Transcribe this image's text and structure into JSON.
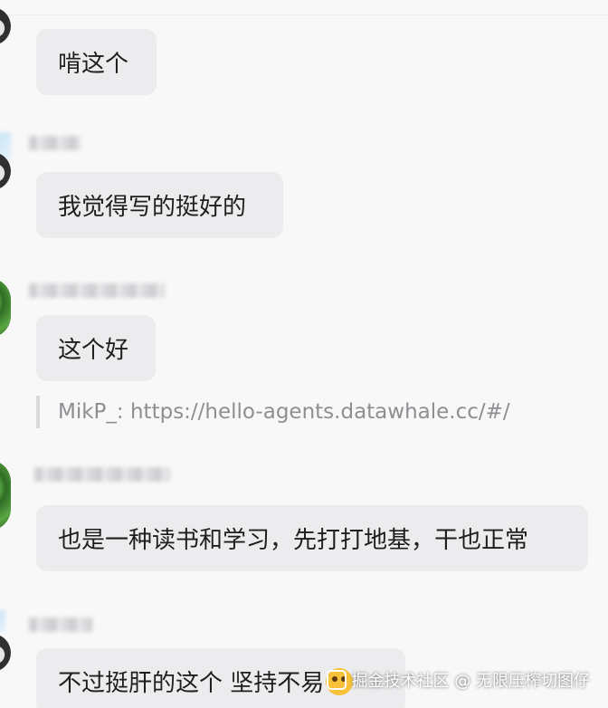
{
  "messages": [
    {
      "text": "啃这个"
    },
    {
      "text": "我觉得写的挺好的"
    },
    {
      "text": "这个好"
    },
    {
      "text": "也是一种读书和学习，先打打地基，干也正常"
    },
    {
      "text": "不过挺肝的这个  坚持不易"
    }
  ],
  "quote": {
    "text": "MikP_: https://hello-agents.datawhale.cc/#/"
  },
  "watermark": {
    "text": "掘金技术社区 @ 无限压榨切图仔"
  }
}
